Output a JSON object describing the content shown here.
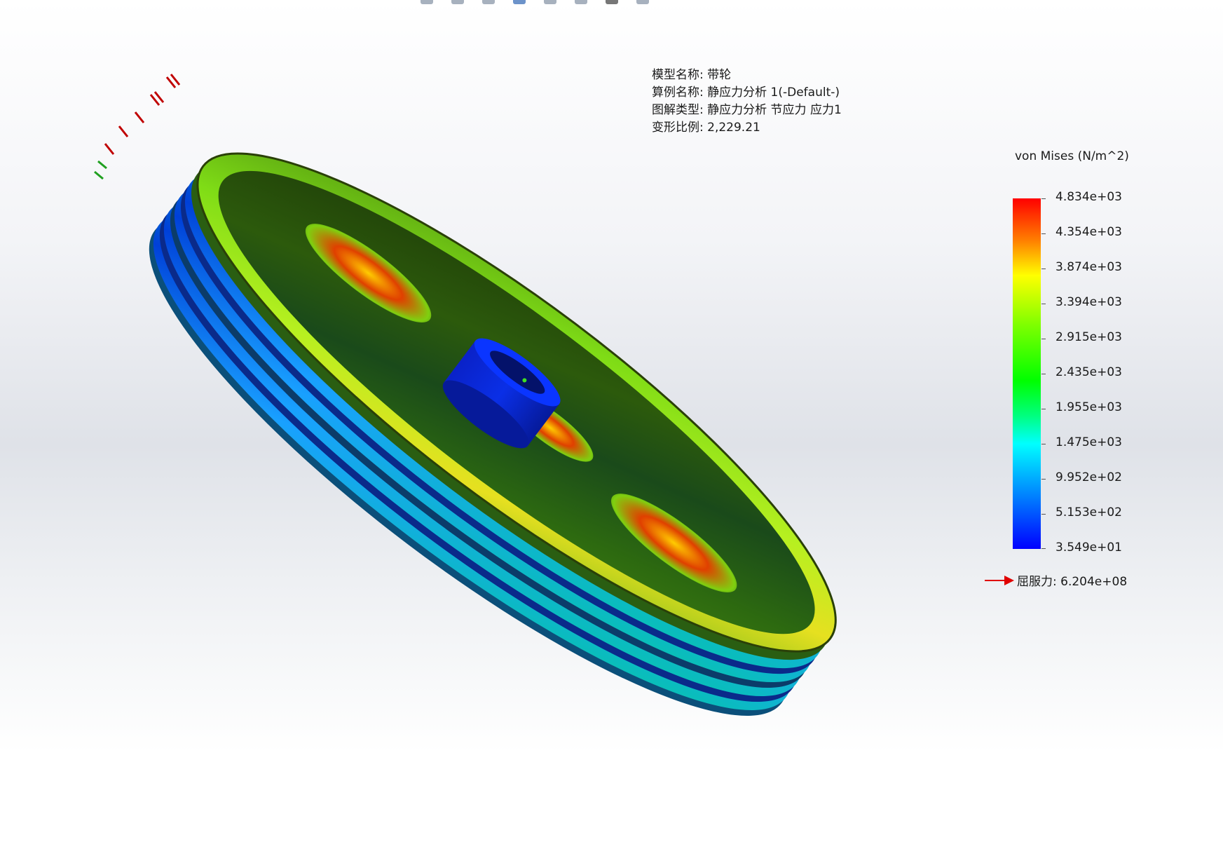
{
  "model_info": {
    "lines": [
      "模型名称: 带轮",
      "算例名称: 静应力分析 1(-Default-)",
      "图解类型: 静应力分析 节应力 应力1",
      "变形比例: 2,229.21"
    ]
  },
  "legend": {
    "title": "von Mises (N/m^2)",
    "labels": [
      "4.834e+03",
      "4.354e+03",
      "3.874e+03",
      "3.394e+03",
      "2.915e+03",
      "2.435e+03",
      "1.955e+03",
      "1.475e+03",
      "9.952e+02",
      "5.153e+02",
      "3.549e+01"
    ],
    "colors": [
      "#ff0000",
      "#ff7f00",
      "#ffff00",
      "#7fff00",
      "#00ff00",
      "#00ff7f",
      "#00ffff",
      "#0080ff",
      "#0000ff"
    ]
  },
  "yield": {
    "text": "屈服力: 6.204e+08",
    "arrow_color": "#e00000"
  },
  "model": {
    "name": "pulley-stress-plot",
    "colors": {
      "rim_dark": "#2f4a10",
      "groove_blue": "#0033cc",
      "hub_blue": "#0a2bd6",
      "face_green": "#3aa80a",
      "hot_red": "#d42a00"
    }
  },
  "toolbar": {
    "icons": [
      "view-icon",
      "zoom-icon",
      "section-icon",
      "display-icon",
      "hide-icon",
      "appearance-icon",
      "scene-icon",
      "settings-icon"
    ]
  }
}
